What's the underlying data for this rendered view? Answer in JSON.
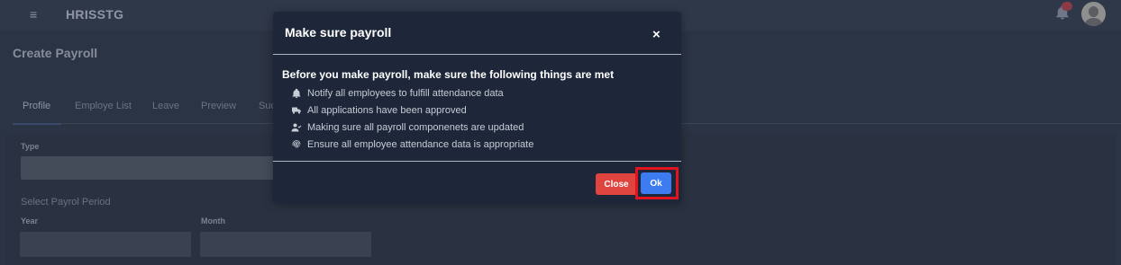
{
  "topbar": {
    "menu_icon": "≡",
    "brand": "HRISSTG"
  },
  "page": {
    "title": "Create Payroll"
  },
  "tabs": [
    {
      "label": "Profile",
      "active": true
    },
    {
      "label": "Employe List",
      "active": false
    },
    {
      "label": "Leave",
      "active": false
    },
    {
      "label": "Preview",
      "active": false
    },
    {
      "label": "Suc",
      "active": false
    }
  ],
  "form": {
    "type_label": "Type",
    "type_value": "",
    "period_label": "Select Payrol Period",
    "year_label": "Year",
    "year_value": "",
    "month_label": "Month",
    "month_value": ""
  },
  "modal": {
    "title": "Make sure payroll",
    "close_icon": "×",
    "heading": "Before you make payroll, make sure the following things are met",
    "items": [
      {
        "icon": "bell-icon",
        "text": "Notify all employees to fulfill attendance data"
      },
      {
        "icon": "truck-icon",
        "text": "All applications have been approved"
      },
      {
        "icon": "user-check-icon",
        "text": "Making sure all payroll componenets are updated"
      },
      {
        "icon": "fingerprint-icon",
        "text": "Ensure all employee attendance data is appropriate"
      }
    ],
    "close_button": "Close",
    "ok_button": "Ok"
  },
  "colors": {
    "backdrop": "#2b3444",
    "modal_bg": "#1e2739",
    "close_button": "#e0443f",
    "ok_button": "#3d7cf0",
    "highlight": "#e3141e"
  }
}
